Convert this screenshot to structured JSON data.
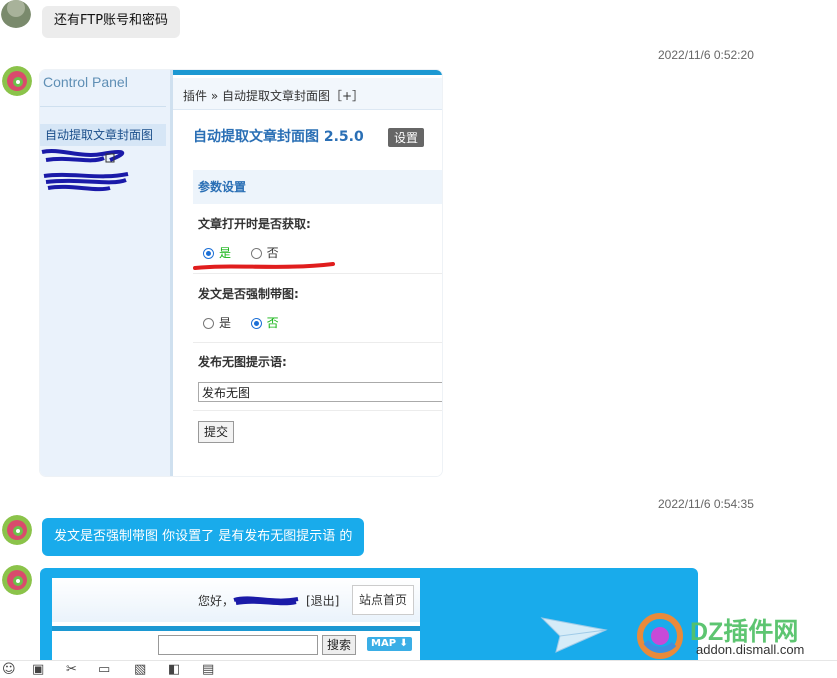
{
  "messages": {
    "m1": {
      "text": "还有FTP账号和密码"
    },
    "ts1": "2022/11/6 0:52:20",
    "ts2": "2022/11/6 0:54:35",
    "m3": {
      "text": "发文是否强制带图 你设置了 是有发布无图提示语 的"
    }
  },
  "control_panel": {
    "title": "Control Panel",
    "menu_item": "自动提取文章封面图",
    "breadcrumb": "插件 » 自动提取文章封面图［+］",
    "plugin_title": "自动提取文章封面图 2.5.0",
    "settings_button": "设置",
    "section_title": "参数设置",
    "q1": {
      "label": "文章打开时是否获取:",
      "yes": "是",
      "no": "否",
      "selected": "yes"
    },
    "q2": {
      "label": "发文是否强制带图:",
      "yes": "是",
      "no": "否",
      "selected": "no"
    },
    "q3": {
      "label": "发布无图提示语:",
      "value": "发布无图"
    },
    "submit": "提交"
  },
  "forum_card": {
    "greeting": "您好，",
    "logout": "[退出]",
    "home": "站点首页",
    "search_button": "搜索",
    "map_button": "MAP"
  },
  "watermark": {
    "brand": "DZ插件网",
    "domain": "addon.dismall.com"
  },
  "colors": {
    "accent_blue": "#19abeb",
    "link_blue": "#2a6fb5",
    "redact_ink": "#1a1aa8",
    "red_mark": "#e01d1d"
  }
}
